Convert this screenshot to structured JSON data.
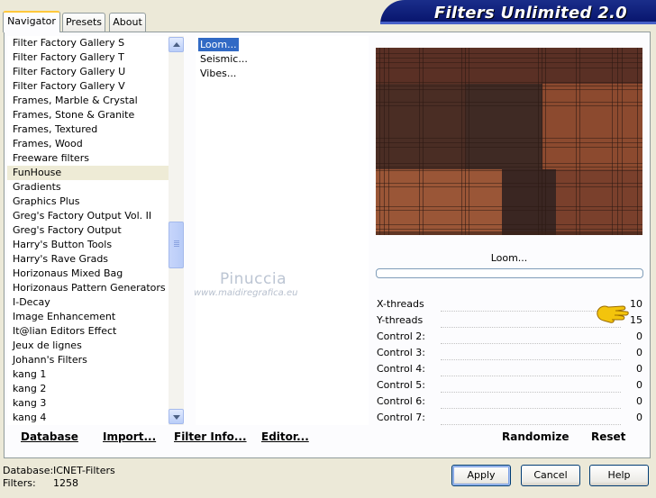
{
  "app": {
    "title": "Filters Unlimited 2.0"
  },
  "tabs": [
    {
      "label": "Navigator",
      "active": true
    },
    {
      "label": "Presets",
      "active": false
    },
    {
      "label": "About",
      "active": false
    }
  ],
  "categories": [
    "Filter Factory Gallery S",
    "Filter Factory Gallery T",
    "Filter Factory Gallery U",
    "Filter Factory Gallery V",
    "Frames, Marble & Crystal",
    "Frames, Stone & Granite",
    "Frames, Textured",
    "Frames, Wood",
    "Freeware filters",
    "FunHouse",
    "Gradients",
    "Graphics Plus",
    "Greg's Factory Output Vol. II",
    "Greg's Factory Output",
    "Harry's Button Tools",
    "Harry's Rave Grads",
    "Horizonaus Mixed Bag",
    "Horizonaus Pattern Generators",
    "I-Decay",
    "Image Enhancement",
    "It@lian Editors Effect",
    "Jeux de lignes",
    "Johann's Filters",
    "kang 1",
    "kang 2",
    "kang 3",
    "kang 4"
  ],
  "selected_category": "FunHouse",
  "filters": [
    "Loom...",
    "Seismic...",
    "Vibes..."
  ],
  "selected_filter": "Loom...",
  "preview": {
    "filter_name": "Loom...",
    "progress": 0
  },
  "controls": [
    {
      "label": "X-threads",
      "value": "10"
    },
    {
      "label": "Y-threads",
      "value": "15"
    },
    {
      "label": "Control 2:",
      "value": "0"
    },
    {
      "label": "Control 3:",
      "value": "0"
    },
    {
      "label": "Control 4:",
      "value": "0"
    },
    {
      "label": "Control 5:",
      "value": "0"
    },
    {
      "label": "Control 6:",
      "value": "0"
    },
    {
      "label": "Control 7:",
      "value": "0"
    }
  ],
  "links": {
    "database": "Database",
    "import": "Import...",
    "filter_info": "Filter Info...",
    "editor": "Editor..."
  },
  "actions": {
    "randomize": "Randomize",
    "reset": "Reset"
  },
  "status": {
    "database_label": "Database:",
    "database_value": "ICNET-Filters",
    "filters_label": "Filters:",
    "filters_value": "1258"
  },
  "buttons": {
    "apply": "Apply",
    "cancel": "Cancel",
    "help": "Help"
  },
  "watermark": {
    "line1": "Pinuccia",
    "line2": "www.maidiregrafica.eu"
  },
  "colors": {
    "banner": "#0a1a78",
    "selection": "#316ac5",
    "preview_base": "#7a3f2a"
  },
  "icons": {
    "pointer": "pointing-hand-icon"
  }
}
